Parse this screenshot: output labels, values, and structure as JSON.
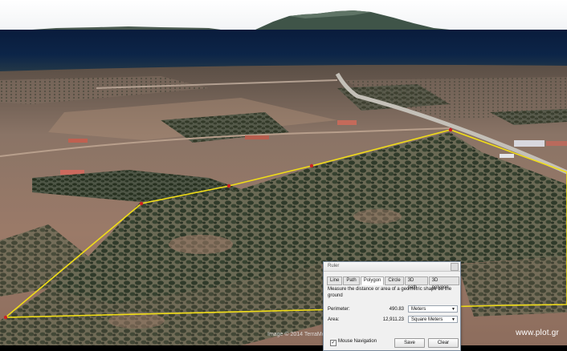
{
  "map": {
    "credit": "Image © 2014 TerraMetrics",
    "watermark": "www.plot.gr",
    "polygon_color": "#f0dd18",
    "vertex_color": "#cc2222"
  },
  "ruler": {
    "title": "Ruler",
    "tabs": [
      "Line",
      "Path",
      "Polygon",
      "Circle",
      "3D path",
      "3D polygon"
    ],
    "active_tab": "Polygon",
    "description": "Measure the distance or area of a geometric shape on the ground",
    "perimeter": {
      "label": "Perimeter:",
      "value": "490.83",
      "unit": "Meters"
    },
    "area": {
      "label": "Area:",
      "value": "12,911.23",
      "unit": "Square Meters"
    },
    "mouse_navigation": {
      "label": "Mouse Navigation",
      "checked": true,
      "mark": "✓"
    },
    "save_label": "Save",
    "clear_label": "Clear"
  }
}
